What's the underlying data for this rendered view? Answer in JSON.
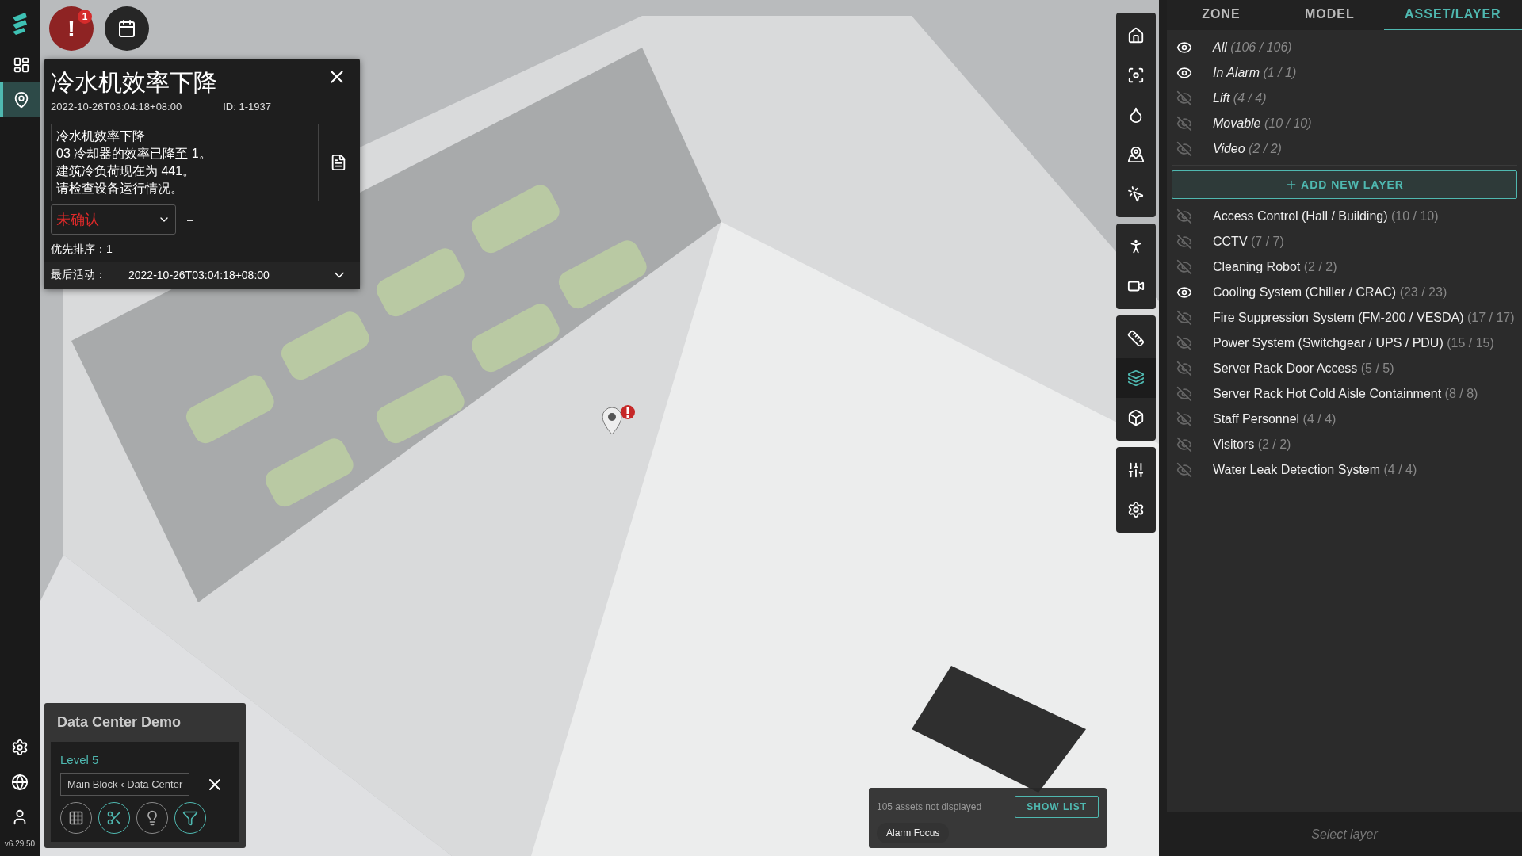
{
  "sidebar": {
    "nav": [
      {
        "selected": false
      },
      {
        "selected": true
      }
    ],
    "version": "v6.29.50"
  },
  "top_buttons": {
    "alarm_symbol": "!",
    "alarm_badge": "1"
  },
  "alarm_card": {
    "title": "冷水机效率下降",
    "timestamp": "2022-10-26T03:04:18+08:00",
    "id": "ID: 1-1937",
    "message": [
      "冷水机效率下降",
      "03 冷却器的效率已降至 1。",
      "建筑冷负荷现在为 441。",
      "请检查设备运行情况。"
    ],
    "status": "未确认",
    "assignee": "–",
    "priority_label": "优先排序：",
    "priority_value": "1",
    "last_activity_label": "最后活动：",
    "last_activity_value": "2022-10-26T03:04:18+08:00",
    "expanded": false
  },
  "toolbar": {
    "groups": [
      {
        "tools": [
          {
            "selected": false
          },
          {
            "selected": false
          },
          {
            "selected": false
          },
          {
            "selected": false
          },
          {
            "selected": false
          }
        ]
      },
      {
        "tools": [
          {
            "selected": false
          },
          {
            "selected": false
          }
        ]
      },
      {
        "tools": [
          {
            "selected": false
          },
          {
            "selected": true
          },
          {
            "selected": false
          }
        ]
      },
      {
        "tools": [
          {
            "selected": false
          },
          {
            "selected": false
          }
        ]
      }
    ]
  },
  "site_panel": {
    "title": "Data Center Demo",
    "level": "Level 5",
    "location": "Main Block ‹ Data Center",
    "tools": [
      {
        "on": false
      },
      {
        "on": true
      },
      {
        "on": false
      },
      {
        "on": true
      }
    ]
  },
  "asset_notice": {
    "text": "105 assets not displayed",
    "button": "SHOW LIST",
    "chip": "Alarm Focus"
  },
  "right_panel": {
    "tabs": [
      {
        "label": "ZONE",
        "selected": false
      },
      {
        "label": "MODEL",
        "selected": false
      },
      {
        "label": "ASSET/LAYER",
        "selected": true
      }
    ],
    "system_layers": [
      {
        "name": "All",
        "count": "(106 / 106)",
        "visible": true
      },
      {
        "name": "In Alarm",
        "count": "(1 / 1)",
        "visible": true
      },
      {
        "name": "Lift",
        "count": "(4 / 4)",
        "visible": false
      },
      {
        "name": "Movable",
        "count": "(10 / 10)",
        "visible": false
      },
      {
        "name": "Video",
        "count": "(2 / 2)",
        "visible": false
      }
    ],
    "add_button": "ADD NEW LAYER",
    "layers": [
      {
        "name": "Access Control (Hall / Building)",
        "count": "(10 / 10)",
        "visible": false
      },
      {
        "name": "CCTV",
        "count": "(7 / 7)",
        "visible": false
      },
      {
        "name": "Cleaning Robot",
        "count": "(2 / 2)",
        "visible": false
      },
      {
        "name": "Cooling System (Chiller / CRAC)",
        "count": "(23 / 23)",
        "visible": true
      },
      {
        "name": "Fire Suppression System (FM-200 / VESDA)",
        "count": "(17 / 17)",
        "visible": false
      },
      {
        "name": "Power System (Switchgear / UPS / PDU)",
        "count": "(15 / 15)",
        "visible": false
      },
      {
        "name": "Server Rack Door Access",
        "count": "(5 / 5)",
        "visible": false
      },
      {
        "name": "Server Rack Hot Cold Aisle Containment",
        "count": "(8 / 8)",
        "visible": false
      },
      {
        "name": "Staff Personnel",
        "count": "(4 / 4)",
        "visible": false
      },
      {
        "name": "Visitors",
        "count": "(2 / 2)",
        "visible": false
      },
      {
        "name": "Water Leak Detection System",
        "count": "(4 / 4)",
        "visible": false
      }
    ],
    "search": {
      "placeholder": "Select layer"
    }
  }
}
